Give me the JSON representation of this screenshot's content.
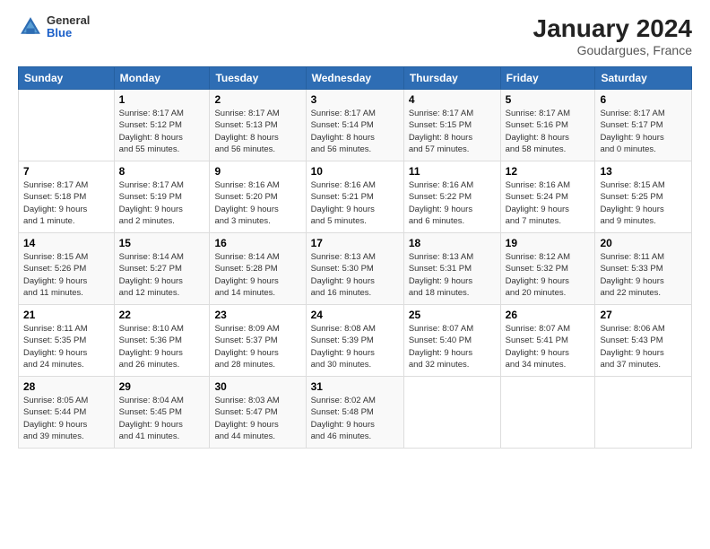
{
  "header": {
    "logo": {
      "line1": "General",
      "line2": "Blue"
    },
    "title": "January 2024",
    "subtitle": "Goudargues, France"
  },
  "weekdays": [
    "Sunday",
    "Monday",
    "Tuesday",
    "Wednesday",
    "Thursday",
    "Friday",
    "Saturday"
  ],
  "weeks": [
    [
      {
        "day": "",
        "sunrise": "",
        "sunset": "",
        "daylight": ""
      },
      {
        "day": "1",
        "sunrise": "Sunrise: 8:17 AM",
        "sunset": "Sunset: 5:12 PM",
        "daylight": "Daylight: 8 hours and 55 minutes."
      },
      {
        "day": "2",
        "sunrise": "Sunrise: 8:17 AM",
        "sunset": "Sunset: 5:13 PM",
        "daylight": "Daylight: 8 hours and 56 minutes."
      },
      {
        "day": "3",
        "sunrise": "Sunrise: 8:17 AM",
        "sunset": "Sunset: 5:14 PM",
        "daylight": "Daylight: 8 hours and 56 minutes."
      },
      {
        "day": "4",
        "sunrise": "Sunrise: 8:17 AM",
        "sunset": "Sunset: 5:15 PM",
        "daylight": "Daylight: 8 hours and 57 minutes."
      },
      {
        "day": "5",
        "sunrise": "Sunrise: 8:17 AM",
        "sunset": "Sunset: 5:16 PM",
        "daylight": "Daylight: 8 hours and 58 minutes."
      },
      {
        "day": "6",
        "sunrise": "Sunrise: 8:17 AM",
        "sunset": "Sunset: 5:17 PM",
        "daylight": "Daylight: 9 hours and 0 minutes."
      }
    ],
    [
      {
        "day": "7",
        "sunrise": "Sunrise: 8:17 AM",
        "sunset": "Sunset: 5:18 PM",
        "daylight": "Daylight: 9 hours and 1 minute."
      },
      {
        "day": "8",
        "sunrise": "Sunrise: 8:17 AM",
        "sunset": "Sunset: 5:19 PM",
        "daylight": "Daylight: 9 hours and 2 minutes."
      },
      {
        "day": "9",
        "sunrise": "Sunrise: 8:16 AM",
        "sunset": "Sunset: 5:20 PM",
        "daylight": "Daylight: 9 hours and 3 minutes."
      },
      {
        "day": "10",
        "sunrise": "Sunrise: 8:16 AM",
        "sunset": "Sunset: 5:21 PM",
        "daylight": "Daylight: 9 hours and 5 minutes."
      },
      {
        "day": "11",
        "sunrise": "Sunrise: 8:16 AM",
        "sunset": "Sunset: 5:22 PM",
        "daylight": "Daylight: 9 hours and 6 minutes."
      },
      {
        "day": "12",
        "sunrise": "Sunrise: 8:16 AM",
        "sunset": "Sunset: 5:24 PM",
        "daylight": "Daylight: 9 hours and 7 minutes."
      },
      {
        "day": "13",
        "sunrise": "Sunrise: 8:15 AM",
        "sunset": "Sunset: 5:25 PM",
        "daylight": "Daylight: 9 hours and 9 minutes."
      }
    ],
    [
      {
        "day": "14",
        "sunrise": "Sunrise: 8:15 AM",
        "sunset": "Sunset: 5:26 PM",
        "daylight": "Daylight: 9 hours and 11 minutes."
      },
      {
        "day": "15",
        "sunrise": "Sunrise: 8:14 AM",
        "sunset": "Sunset: 5:27 PM",
        "daylight": "Daylight: 9 hours and 12 minutes."
      },
      {
        "day": "16",
        "sunrise": "Sunrise: 8:14 AM",
        "sunset": "Sunset: 5:28 PM",
        "daylight": "Daylight: 9 hours and 14 minutes."
      },
      {
        "day": "17",
        "sunrise": "Sunrise: 8:13 AM",
        "sunset": "Sunset: 5:30 PM",
        "daylight": "Daylight: 9 hours and 16 minutes."
      },
      {
        "day": "18",
        "sunrise": "Sunrise: 8:13 AM",
        "sunset": "Sunset: 5:31 PM",
        "daylight": "Daylight: 9 hours and 18 minutes."
      },
      {
        "day": "19",
        "sunrise": "Sunrise: 8:12 AM",
        "sunset": "Sunset: 5:32 PM",
        "daylight": "Daylight: 9 hours and 20 minutes."
      },
      {
        "day": "20",
        "sunrise": "Sunrise: 8:11 AM",
        "sunset": "Sunset: 5:33 PM",
        "daylight": "Daylight: 9 hours and 22 minutes."
      }
    ],
    [
      {
        "day": "21",
        "sunrise": "Sunrise: 8:11 AM",
        "sunset": "Sunset: 5:35 PM",
        "daylight": "Daylight: 9 hours and 24 minutes."
      },
      {
        "day": "22",
        "sunrise": "Sunrise: 8:10 AM",
        "sunset": "Sunset: 5:36 PM",
        "daylight": "Daylight: 9 hours and 26 minutes."
      },
      {
        "day": "23",
        "sunrise": "Sunrise: 8:09 AM",
        "sunset": "Sunset: 5:37 PM",
        "daylight": "Daylight: 9 hours and 28 minutes."
      },
      {
        "day": "24",
        "sunrise": "Sunrise: 8:08 AM",
        "sunset": "Sunset: 5:39 PM",
        "daylight": "Daylight: 9 hours and 30 minutes."
      },
      {
        "day": "25",
        "sunrise": "Sunrise: 8:07 AM",
        "sunset": "Sunset: 5:40 PM",
        "daylight": "Daylight: 9 hours and 32 minutes."
      },
      {
        "day": "26",
        "sunrise": "Sunrise: 8:07 AM",
        "sunset": "Sunset: 5:41 PM",
        "daylight": "Daylight: 9 hours and 34 minutes."
      },
      {
        "day": "27",
        "sunrise": "Sunrise: 8:06 AM",
        "sunset": "Sunset: 5:43 PM",
        "daylight": "Daylight: 9 hours and 37 minutes."
      }
    ],
    [
      {
        "day": "28",
        "sunrise": "Sunrise: 8:05 AM",
        "sunset": "Sunset: 5:44 PM",
        "daylight": "Daylight: 9 hours and 39 minutes."
      },
      {
        "day": "29",
        "sunrise": "Sunrise: 8:04 AM",
        "sunset": "Sunset: 5:45 PM",
        "daylight": "Daylight: 9 hours and 41 minutes."
      },
      {
        "day": "30",
        "sunrise": "Sunrise: 8:03 AM",
        "sunset": "Sunset: 5:47 PM",
        "daylight": "Daylight: 9 hours and 44 minutes."
      },
      {
        "day": "31",
        "sunrise": "Sunrise: 8:02 AM",
        "sunset": "Sunset: 5:48 PM",
        "daylight": "Daylight: 9 hours and 46 minutes."
      },
      {
        "day": "",
        "sunrise": "",
        "sunset": "",
        "daylight": ""
      },
      {
        "day": "",
        "sunrise": "",
        "sunset": "",
        "daylight": ""
      },
      {
        "day": "",
        "sunrise": "",
        "sunset": "",
        "daylight": ""
      }
    ]
  ]
}
